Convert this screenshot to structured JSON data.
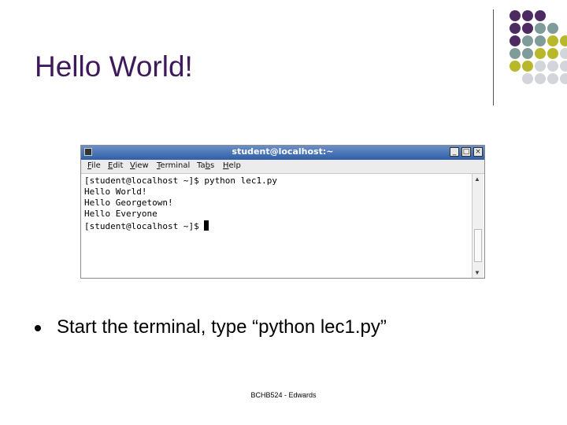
{
  "slide": {
    "title": "Hello World!",
    "bullet": "Start the terminal, type “python lec1.py”",
    "footer": "BCHB524 - Edwards"
  },
  "decor": {
    "dot_colors": [
      "#4e2a63",
      "#7f9c9a",
      "#b8b82a",
      "#d4d4dc"
    ]
  },
  "terminal": {
    "window_title": "student@localhost:~",
    "buttons": {
      "minimize": "_",
      "maximize": "□",
      "close": "×"
    },
    "menu": [
      {
        "pre": "",
        "u": "F",
        "post": "ile"
      },
      {
        "pre": "",
        "u": "E",
        "post": "dit"
      },
      {
        "pre": "",
        "u": "V",
        "post": "iew"
      },
      {
        "pre": "",
        "u": "T",
        "post": "erminal"
      },
      {
        "pre": "Ta",
        "u": "b",
        "post": "s"
      },
      {
        "pre": "",
        "u": "H",
        "post": "elp"
      }
    ],
    "lines": [
      "[student@localhost ~]$ python lec1.py",
      "Hello World!",
      "Hello Georgetown!",
      "Hello Everyone",
      "[student@localhost ~]$ "
    ]
  }
}
